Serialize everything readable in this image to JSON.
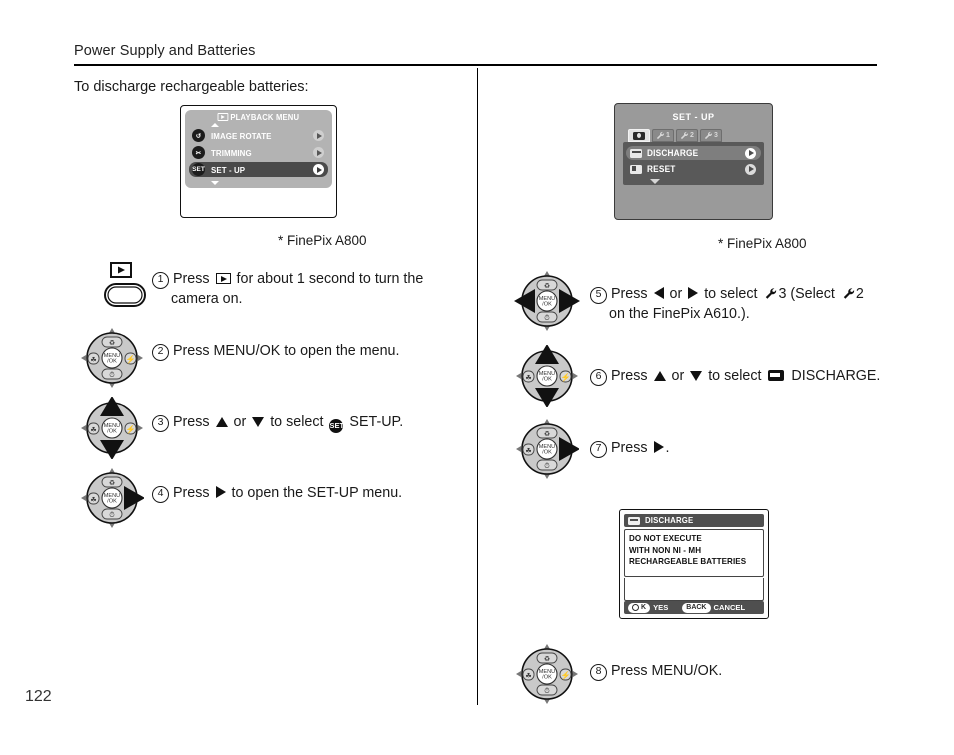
{
  "header": {
    "section_title": "Power Supply and Batteries",
    "page_number": "122"
  },
  "intro": {
    "text": "To discharge rechargeable batteries:"
  },
  "left_column": {
    "lcd": {
      "title": "PLAYBACK MENU",
      "title_icon": "playback-icon",
      "rows": [
        {
          "icon_label": "↺",
          "label": "IMAGE ROTATE",
          "icon_name": "rotate-icon",
          "selected": false
        },
        {
          "icon_label": "✂",
          "label": "TRIMMING",
          "icon_name": "trimming-icon",
          "selected": false
        },
        {
          "icon_label": "SET",
          "label": "SET - UP",
          "icon_name": "setup-icon",
          "selected": true
        }
      ]
    },
    "caption": "* FinePix A800",
    "steps": [
      {
        "number": "1",
        "graphic": "playback-button",
        "text_parts": [
          {
            "type": "text",
            "value": "Press "
          },
          {
            "type": "icon",
            "value": "playback-icon"
          },
          {
            "type": "text",
            "value": " for about 1 second to turn the camera on."
          }
        ],
        "plain": "Press ▶ for about 1 second to turn the camera on."
      },
      {
        "number": "2",
        "graphic": "nav-wheel",
        "plain": "Press MENU/OK to open the menu."
      },
      {
        "number": "3",
        "graphic": "nav-wheel-up-down",
        "plain": "Press ▲ or ▼ to select SET-UP."
      },
      {
        "number": "4",
        "graphic": "nav-wheel-right",
        "plain": "Press ▶ to open the SET-UP menu."
      }
    ],
    "step1_before": "Press",
    "step1_after": "for about 1 second to turn the",
    "step1_line2": "camera on.",
    "step2_text": "Press MENU/OK to open the menu.",
    "step3_a": "Press",
    "step3_or": "or",
    "step3_b": "to select",
    "step3_c": "SET-UP.",
    "step3_icon_label": "SET",
    "step4_a": "Press",
    "step4_b": "to open the SET-UP menu."
  },
  "right_column": {
    "lcd": {
      "title": "SET - UP",
      "tabs": [
        {
          "name": "camera-tab",
          "label": "",
          "icon": "camera-icon",
          "active": true
        },
        {
          "name": "wrench-1-tab",
          "label": "1",
          "icon": "wrench-icon",
          "active": false
        },
        {
          "name": "wrench-2-tab",
          "label": "2",
          "icon": "wrench-icon",
          "active": false
        },
        {
          "name": "wrench-3-tab",
          "label": "3",
          "icon": "wrench-icon",
          "active": false
        }
      ],
      "rows": [
        {
          "label": "DISCHARGE",
          "icon_name": "discharge-icon",
          "selected": true
        },
        {
          "label": "RESET",
          "icon_name": "reset-icon",
          "selected": false
        }
      ]
    },
    "caption": "* FinePix A800",
    "step5_a": "Press",
    "step5_or": "or",
    "step5_b": "to select",
    "step5_wrench1": "3",
    "step5_paren_open": "(Select",
    "step5_wrench2": "2",
    "step5_line2": "on the FinePix A610.).",
    "step6_a": "Press",
    "step6_or": "or",
    "step6_b": "to select",
    "step6_c": "DISCHARGE.",
    "step7_a": "Press",
    "step7_b": ".",
    "step8_text": "Press MENU/OK.",
    "step_numbers": {
      "s5": "5",
      "s6": "6",
      "s7": "7",
      "s8": "8"
    },
    "dialog": {
      "title": "DISCHARGE",
      "lines": [
        "DO NOT EXECUTE",
        "WITH NON NI - MH",
        "RECHARGEABLE BATTERIES"
      ],
      "ok_pill": "K",
      "ok_word": "YES",
      "back_pill": "BACK",
      "back_word": "CANCEL"
    }
  },
  "colors": {
    "ink": "#1a1a1a",
    "lcd_bg": "#9a9a9a",
    "lcd_panel": "#b3b3b3",
    "lcd_list": "#595959",
    "lcd_selected": "#4a4a4a",
    "wheel_gray": "#c9c9c9"
  }
}
